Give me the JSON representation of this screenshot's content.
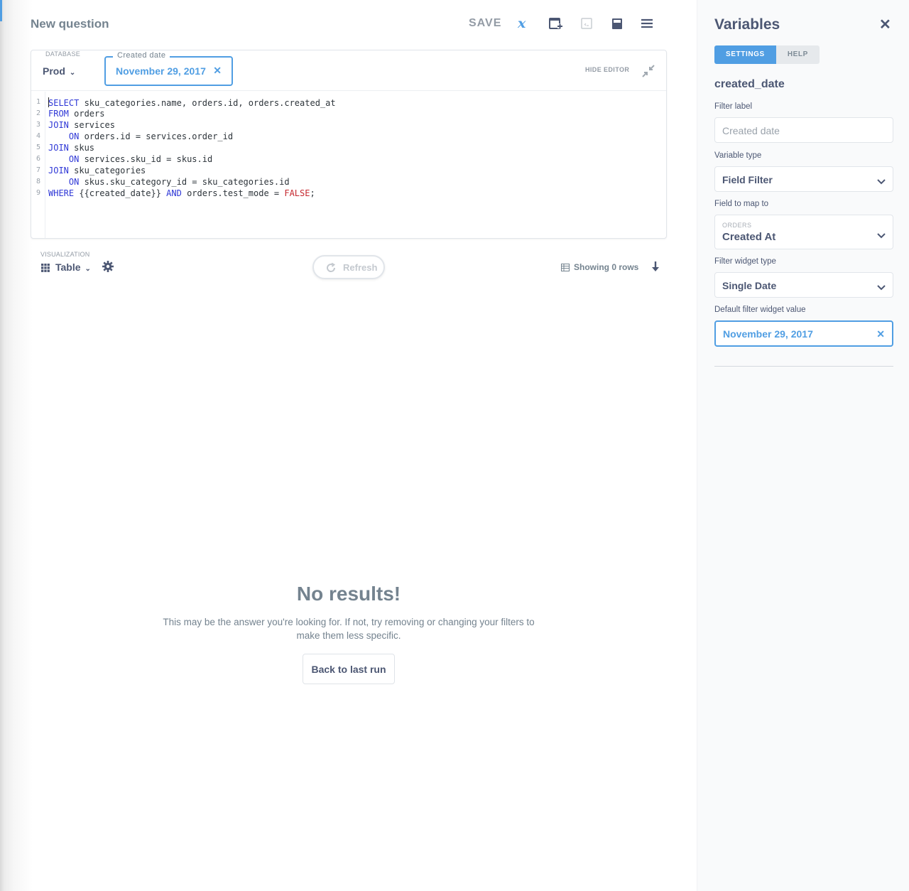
{
  "header": {
    "title": "New question",
    "save_label": "SAVE"
  },
  "editor": {
    "database_label": "DATABASE",
    "database_value": "Prod",
    "date_filter": {
      "label": "Created date",
      "value": "November 29, 2017"
    },
    "hide_editor_label": "HIDE EDITOR",
    "line_numbers": [
      "1",
      "2",
      "3",
      "4",
      "5",
      "6",
      "7",
      "8",
      "9"
    ]
  },
  "visualization": {
    "label": "VISUALIZATION",
    "type": "Table",
    "refresh_label": "Refresh",
    "rows_info": "Showing 0 rows"
  },
  "empty_state": {
    "title": "No results!",
    "message": "This may be the answer you're looking for. If not, try removing or changing your filters to make them less specific.",
    "button": "Back to last run"
  },
  "sidebar": {
    "title": "Variables",
    "tabs": [
      "SETTINGS",
      "HELP"
    ],
    "variable_name": "created_date",
    "filter_label": {
      "label": "Filter label",
      "placeholder": "Created date"
    },
    "variable_type": {
      "label": "Variable type",
      "value": "Field Filter"
    },
    "field_map": {
      "label": "Field to map to",
      "table": "ORDERS",
      "value": "Created At"
    },
    "widget_type": {
      "label": "Filter widget type",
      "value": "Single Date"
    },
    "default_value": {
      "label": "Default filter widget value",
      "value": "November 29, 2017"
    }
  },
  "colors": {
    "accent": "#509ee3",
    "text": "#4c5773",
    "muted": "#74838f",
    "keyword": "#2e37d6",
    "literal": "#c5282f"
  }
}
